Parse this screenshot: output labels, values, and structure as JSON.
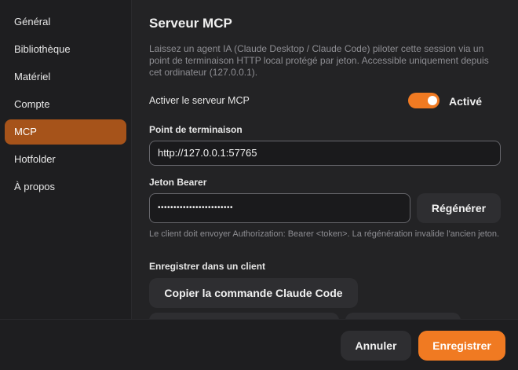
{
  "sidebar": {
    "items": [
      {
        "label": "Général"
      },
      {
        "label": "Bibliothèque"
      },
      {
        "label": "Matériel"
      },
      {
        "label": "Compte"
      },
      {
        "label": "MCP",
        "active": true
      },
      {
        "label": "Hotfolder"
      },
      {
        "label": "À propos"
      }
    ]
  },
  "main": {
    "title": "Serveur MCP",
    "description": "Laissez un agent IA (Claude Desktop / Claude Code) piloter cette session via un point de terminaison HTTP local protégé par jeton. Accessible uniquement depuis cet ordinateur (127.0.0.1).",
    "enable_label": "Activer le serveur MCP",
    "enable_state": "Activé",
    "enabled": true,
    "endpoint_label": "Point de terminaison",
    "endpoint_value": "http://127.0.0.1:57765",
    "token_label": "Jeton Bearer",
    "token_value": "••••••••••••••••••••••••",
    "regenerate_label": "Régénérer",
    "token_hint": "Le client doit envoyer Authorization: Bearer <token>. La régénération invalide l'ancien jeton.",
    "register_label": "Enregistrer dans un client",
    "copy_claude_code_label": "Copier la commande Claude Code"
  },
  "footer": {
    "cancel_label": "Annuler",
    "save_label": "Enregistrer"
  },
  "colors": {
    "accent": "#f07a22",
    "sidebar_active": "#a6531a"
  }
}
